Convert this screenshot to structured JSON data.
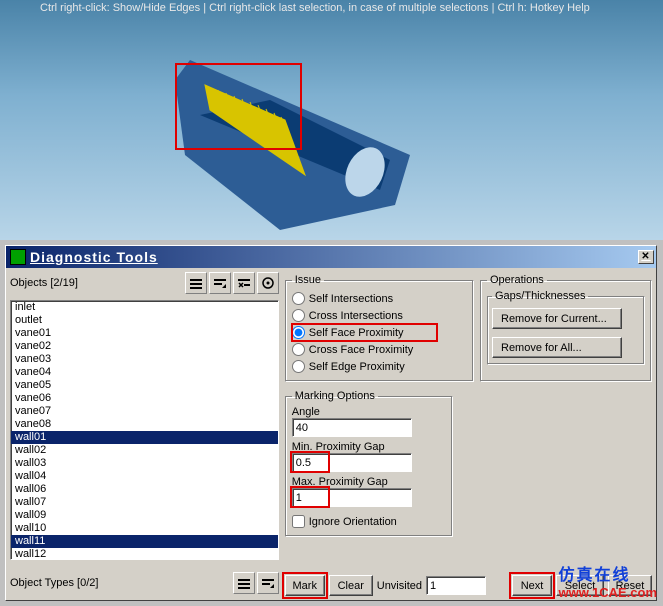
{
  "viewport": {
    "hint": "Ctrl right-click: Show/Hide Edges | Ctrl right-click last selection, in case of multiple selections | Ctrl h: Hotkey Help"
  },
  "dialog": {
    "title": "Diagnostic Tools",
    "objects_label": "Objects [2/19]",
    "object_types_label": "Object Types [0/2]",
    "list_items": [
      {
        "label": "inlet",
        "selected": false
      },
      {
        "label": "outlet",
        "selected": false
      },
      {
        "label": "vane01",
        "selected": false
      },
      {
        "label": "vane02",
        "selected": false
      },
      {
        "label": "vane03",
        "selected": false
      },
      {
        "label": "vane04",
        "selected": false
      },
      {
        "label": "vane05",
        "selected": false
      },
      {
        "label": "vane06",
        "selected": false
      },
      {
        "label": "vane07",
        "selected": false
      },
      {
        "label": "vane08",
        "selected": false
      },
      {
        "label": "wall01",
        "selected": true
      },
      {
        "label": "wall02",
        "selected": false
      },
      {
        "label": "wall03",
        "selected": false
      },
      {
        "label": "wall04",
        "selected": false
      },
      {
        "label": "wall06",
        "selected": false
      },
      {
        "label": "wall07",
        "selected": false
      },
      {
        "label": "wall09",
        "selected": false
      },
      {
        "label": "wall10",
        "selected": false
      },
      {
        "label": "wall11",
        "selected": true
      },
      {
        "label": "wall12",
        "selected": false
      }
    ],
    "issue": {
      "legend": "Issue",
      "opts": {
        "self_int": "Self Intersections",
        "cross_int": "Cross Intersections",
        "self_face": "Self Face Proximity",
        "cross_face": "Cross Face Proximity",
        "self_edge": "Self Edge Proximity"
      },
      "selected": "self_face"
    },
    "marking": {
      "legend": "Marking Options",
      "angle_label": "Angle",
      "angle_value": "40",
      "min_gap_label": "Min. Proximity Gap",
      "min_gap_value": "0.5",
      "max_gap_label": "Max. Proximity Gap",
      "max_gap_value": "1",
      "ignore_label": "Ignore Orientation",
      "ignore_checked": false
    },
    "operations": {
      "legend": "Operations",
      "gaps_legend": "Gaps/Thicknesses",
      "remove_current": "Remove for Current...",
      "remove_all": "Remove for All..."
    },
    "buttons": {
      "mark": "Mark",
      "clear": "Clear",
      "unvisited_label": "Unvisited",
      "unvisited_value": "1",
      "next": "Next",
      "select": "Select",
      "reset": "Reset"
    }
  },
  "watermark": {
    "cn": "仿真在线",
    "url": "www.1CAE.com"
  }
}
